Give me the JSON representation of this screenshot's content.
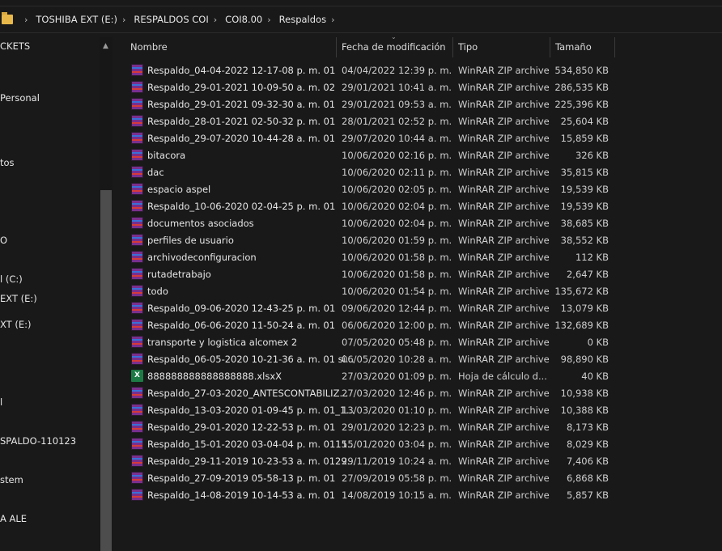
{
  "breadcrumb": [
    "TOSHIBA EXT (E:)",
    "RESPALDOS COI",
    "COI8.00",
    "Respaldos"
  ],
  "sidebar": [
    "CKETS",
    "Personal",
    "tos",
    "O",
    "l (C:)",
    "EXT (E:)",
    "XT (E:)",
    "l",
    "SPALDO-110123",
    "stem",
    "A ALE"
  ],
  "columns": {
    "name": "Nombre",
    "date": "Fecha de modificación",
    "type": "Tipo",
    "size": "Tamaño"
  },
  "files": [
    {
      "name": "Respaldo_04-04-2022 12-17-08 p. m. 01",
      "date": "04/04/2022 12:39 p. m.",
      "type": "WinRAR ZIP archive",
      "size": "534,850 KB",
      "icon": "winrar-icon"
    },
    {
      "name": "Respaldo_29-01-2021 10-09-50 a. m. 02",
      "date": "29/01/2021 10:41 a. m.",
      "type": "WinRAR ZIP archive",
      "size": "286,535 KB",
      "icon": "winrar-icon"
    },
    {
      "name": "Respaldo_29-01-2021 09-32-30 a. m. 01",
      "date": "29/01/2021 09:53 a. m.",
      "type": "WinRAR ZIP archive",
      "size": "225,396 KB",
      "icon": "winrar-icon"
    },
    {
      "name": "Respaldo_28-01-2021 02-50-32 p. m. 01",
      "date": "28/01/2021 02:52 p. m.",
      "type": "WinRAR ZIP archive",
      "size": "25,604 KB",
      "icon": "winrar-icon"
    },
    {
      "name": "Respaldo_29-07-2020 10-44-28 a. m. 01",
      "date": "29/07/2020 10:44 a. m.",
      "type": "WinRAR ZIP archive",
      "size": "15,859 KB",
      "icon": "winrar-icon"
    },
    {
      "name": "bitacora",
      "date": "10/06/2020 02:16 p. m.",
      "type": "WinRAR ZIP archive",
      "size": "326 KB",
      "icon": "winrar-icon"
    },
    {
      "name": "dac",
      "date": "10/06/2020 02:11 p. m.",
      "type": "WinRAR ZIP archive",
      "size": "35,815 KB",
      "icon": "winrar-icon"
    },
    {
      "name": "espacio aspel",
      "date": "10/06/2020 02:05 p. m.",
      "type": "WinRAR ZIP archive",
      "size": "19,539 KB",
      "icon": "winrar-icon"
    },
    {
      "name": "Respaldo_10-06-2020 02-04-25 p. m. 01",
      "date": "10/06/2020 02:04 p. m.",
      "type": "WinRAR ZIP archive",
      "size": "19,539 KB",
      "icon": "winrar-icon"
    },
    {
      "name": "documentos asociados",
      "date": "10/06/2020 02:04 p. m.",
      "type": "WinRAR ZIP archive",
      "size": "38,685 KB",
      "icon": "winrar-icon"
    },
    {
      "name": "perfiles de usuario",
      "date": "10/06/2020 01:59 p. m.",
      "type": "WinRAR ZIP archive",
      "size": "38,552 KB",
      "icon": "winrar-icon"
    },
    {
      "name": "archivodeconfiguracion",
      "date": "10/06/2020 01:58 p. m.",
      "type": "WinRAR ZIP archive",
      "size": "112 KB",
      "icon": "winrar-icon"
    },
    {
      "name": "rutadetrabajo",
      "date": "10/06/2020 01:58 p. m.",
      "type": "WinRAR ZIP archive",
      "size": "2,647 KB",
      "icon": "winrar-icon"
    },
    {
      "name": "todo",
      "date": "10/06/2020 01:54 p. m.",
      "type": "WinRAR ZIP archive",
      "size": "135,672 KB",
      "icon": "winrar-icon"
    },
    {
      "name": "Respaldo_09-06-2020 12-43-25 p. m. 01",
      "date": "09/06/2020 12:44 p. m.",
      "type": "WinRAR ZIP archive",
      "size": "13,079 KB",
      "icon": "winrar-icon"
    },
    {
      "name": "Respaldo_06-06-2020 11-50-24 a. m. 01",
      "date": "06/06/2020 12:00 p. m.",
      "type": "WinRAR ZIP archive",
      "size": "132,689 KB",
      "icon": "winrar-icon"
    },
    {
      "name": "transporte y logistica alcomex 2",
      "date": "07/05/2020 05:48 p. m.",
      "type": "WinRAR ZIP archive",
      "size": "0 KB",
      "icon": "winrar-icon"
    },
    {
      "name": "Respaldo_06-05-2020 10-21-36 a. m. 01 si...",
      "date": "06/05/2020 10:28 a. m.",
      "type": "WinRAR ZIP archive",
      "size": "98,890 KB",
      "icon": "winrar-icon"
    },
    {
      "name": "888888888888888888.xlsxX",
      "date": "27/03/2020 01:09 p. m.",
      "type": "Hoja de cálculo d...",
      "size": "40 KB",
      "icon": "excel-icon"
    },
    {
      "name": "Respaldo_27-03-2020_ANTESCONTABILIZ...",
      "date": "27/03/2020 12:46 p. m.",
      "type": "WinRAR ZIP archive",
      "size": "10,938 KB",
      "icon": "winrar-icon"
    },
    {
      "name": "Respaldo_13-03-2020 01-09-45 p. m. 01_1...",
      "date": "13/03/2020 01:10 p. m.",
      "type": "WinRAR ZIP archive",
      "size": "10,388 KB",
      "icon": "winrar-icon"
    },
    {
      "name": "Respaldo_29-01-2020 12-22-53 p. m. 01",
      "date": "29/01/2020 12:23 p. m.",
      "type": "WinRAR ZIP archive",
      "size": "8,173 KB",
      "icon": "winrar-icon"
    },
    {
      "name": "Respaldo_15-01-2020 03-04-04 p. m. 0115...",
      "date": "15/01/2020 03:04 p. m.",
      "type": "WinRAR ZIP archive",
      "size": "8,029 KB",
      "icon": "winrar-icon"
    },
    {
      "name": "Respaldo_29-11-2019 10-23-53 a. m. 0129...",
      "date": "29/11/2019 10:24 a. m.",
      "type": "WinRAR ZIP archive",
      "size": "7,406 KB",
      "icon": "winrar-icon"
    },
    {
      "name": "Respaldo_27-09-2019 05-58-13 p. m. 01",
      "date": "27/09/2019 05:58 p. m.",
      "type": "WinRAR ZIP archive",
      "size": "6,868 KB",
      "icon": "winrar-icon"
    },
    {
      "name": "Respaldo_14-08-2019 10-14-53 a. m. 01",
      "date": "14/08/2019 10:15 a. m.",
      "type": "WinRAR ZIP archive",
      "size": "5,857 KB",
      "icon": "winrar-icon"
    }
  ]
}
